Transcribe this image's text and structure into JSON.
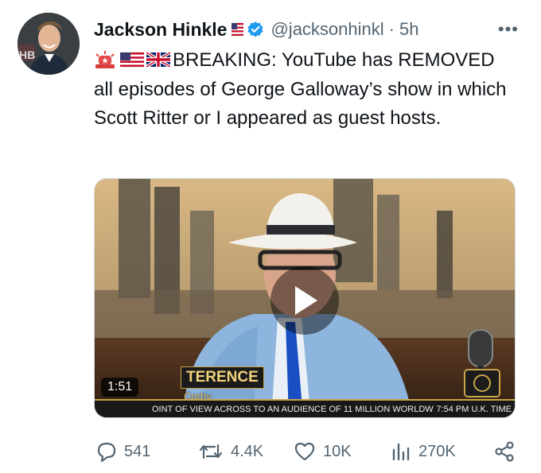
{
  "tweet": {
    "author_name": "Jackson Hinkle",
    "handle": "@jacksonhinkl",
    "time_sep": "·",
    "time": "5h",
    "more": "•••",
    "text": "BREAKING: YouTube has REMOVED all episodes of George Galloway’s show in which Scott Ritter or I appeared as guest hosts.",
    "icons": [
      "us-flag-icon",
      "verified-badge-icon",
      "siren-icon",
      "us-flag-icon",
      "uk-flag-icon"
    ]
  },
  "video": {
    "duration": "1:51",
    "lower_third_name": "TERENCE",
    "lower_third_place": "Corby",
    "avatar_badge": "HB",
    "ticker_text": "OINT OF VIEW ACROSS TO AN AUDIENCE OF 11 MILLION WORLDW",
    "ticker_time": "7:54 PM U.K. TIME",
    "icons": [
      "play-icon",
      "telephone-icon",
      "microphone-icon"
    ]
  },
  "actions": {
    "replies": "541",
    "reposts": "4.4K",
    "likes": "10K",
    "views": "270K"
  },
  "colors": {
    "verified_blue": "#1d9bf0",
    "muted_gray": "#536471",
    "ticker_gold": "#c8a44a"
  }
}
